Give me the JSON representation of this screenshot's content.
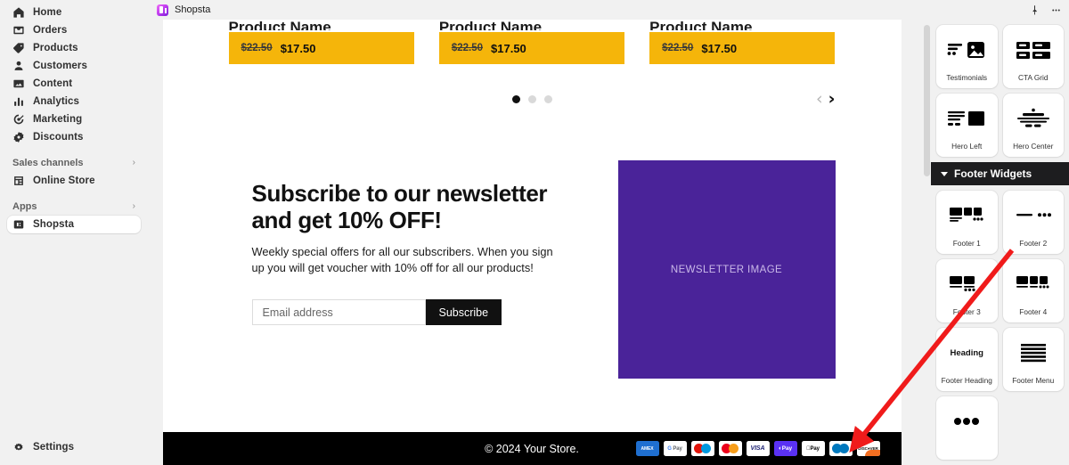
{
  "sidebar": {
    "items": [
      {
        "label": "Home",
        "icon": "home-icon"
      },
      {
        "label": "Orders",
        "icon": "orders-icon"
      },
      {
        "label": "Products",
        "icon": "products-icon"
      },
      {
        "label": "Customers",
        "icon": "customers-icon"
      },
      {
        "label": "Content",
        "icon": "content-icon"
      },
      {
        "label": "Analytics",
        "icon": "analytics-icon"
      },
      {
        "label": "Marketing",
        "icon": "marketing-icon"
      },
      {
        "label": "Discounts",
        "icon": "discounts-icon"
      }
    ],
    "sales_channels": {
      "label": "Sales channels",
      "chevron": "›",
      "items": [
        {
          "label": "Online Store",
          "icon": "store-icon"
        }
      ]
    },
    "apps": {
      "label": "Apps",
      "chevron": "›",
      "items": [
        {
          "label": "Shopsta",
          "icon": "shopsta-icon",
          "active": true
        }
      ]
    },
    "settings": {
      "label": "Settings",
      "icon": "gear-icon"
    }
  },
  "topbar": {
    "app_title": "Shopsta",
    "pin_icon": "pin-icon",
    "more_icon": "more-horizontal-icon"
  },
  "preview": {
    "carousel": {
      "products": [
        {
          "title": "Product Name",
          "price_old": "$22.50",
          "price_new": "$17.50"
        },
        {
          "title": "Product Name",
          "price_old": "$22.50",
          "price_new": "$17.50"
        },
        {
          "title": "Product Name",
          "price_old": "$22.50",
          "price_new": "$17.50"
        }
      ],
      "dots": [
        true,
        false,
        false
      ],
      "prev_arrow": "‹",
      "next_arrow": "›",
      "price_band_color": "#f5b50a"
    },
    "newsletter": {
      "heading": "Subscribe to our newsletter and get 10% OFF!",
      "body": "Weekly special offers for all our subscribers. When you sign up you will get voucher with 10% off for all our products!",
      "email_placeholder": "Email address",
      "email_value": "",
      "button_label": "Subscribe",
      "image_placeholder": "NEWSLETTER IMAGE",
      "image_color": "#4a2399"
    },
    "footer": {
      "copyright": "© 2024 Your Store.",
      "payments": [
        {
          "name": "amex",
          "label": "AMEX"
        },
        {
          "name": "google-pay",
          "label": "Pay"
        },
        {
          "name": "maestro",
          "label": ""
        },
        {
          "name": "mastercard",
          "label": ""
        },
        {
          "name": "visa",
          "label": "VISA"
        },
        {
          "name": "shop-pay",
          "label": "◐Pay"
        },
        {
          "name": "apple-pay",
          "label": "Pay"
        },
        {
          "name": "diners-club",
          "label": ""
        },
        {
          "name": "discover",
          "label": "DISC●VER"
        }
      ]
    }
  },
  "widget_panel": {
    "top_widgets": [
      {
        "label": "Testimonials",
        "icon": "testimonials-thumb"
      },
      {
        "label": "CTA Grid",
        "icon": "cta-grid-thumb"
      },
      {
        "label": "Hero Left",
        "icon": "hero-left-thumb"
      },
      {
        "label": "Hero Center",
        "icon": "hero-center-thumb"
      }
    ],
    "section": {
      "label": "Footer Widgets",
      "collapse_icon": "triangle-down-icon"
    },
    "footer_widgets": [
      {
        "label": "Footer 1",
        "icon": "footer-1-thumb"
      },
      {
        "label": "Footer 2",
        "icon": "footer-2-thumb"
      },
      {
        "label": "Footer 3",
        "icon": "footer-3-thumb"
      },
      {
        "label": "Footer 4",
        "icon": "footer-4-thumb"
      },
      {
        "label": "Footer Heading",
        "icon": "footer-heading-thumb",
        "thumb_text": "Heading"
      },
      {
        "label": "Footer Menu",
        "icon": "footer-menu-thumb"
      },
      {
        "label": "",
        "icon": "social-dots-thumb"
      }
    ]
  },
  "annotation": {
    "arrow_color": "#f01b1b",
    "type": "arrow"
  }
}
